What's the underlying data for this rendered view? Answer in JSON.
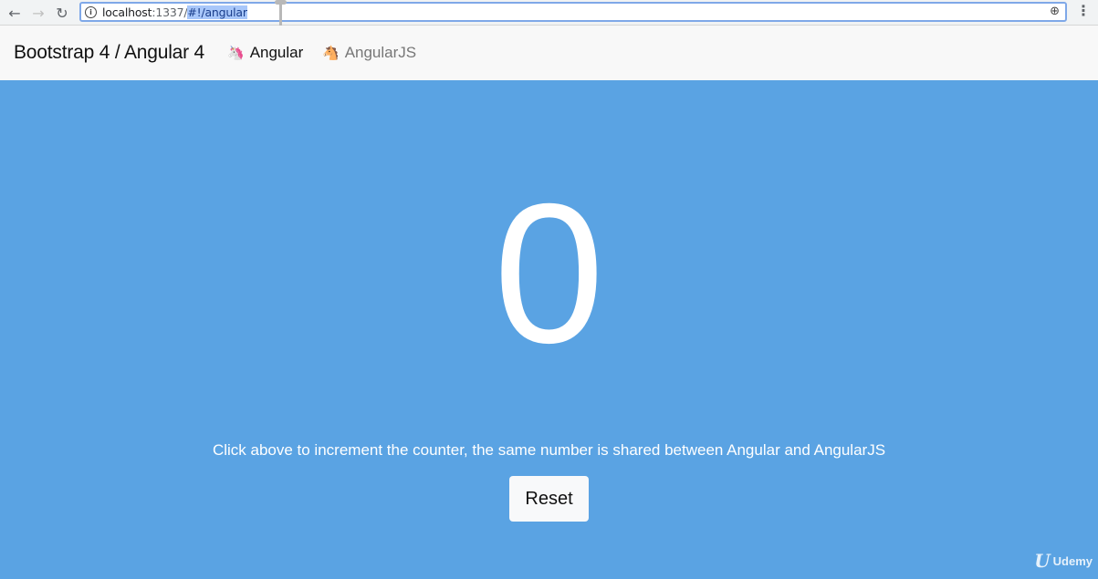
{
  "browser": {
    "url_host": "localhost",
    "url_port": ":1337/",
    "url_selected": "#!/angular",
    "back_icon": "arrow-left-icon",
    "forward_icon": "arrow-right-icon",
    "reload_icon": "reload-icon",
    "zoom_icon": "zoom-icon",
    "menu_icon": "kebab-menu-icon"
  },
  "navbar": {
    "brand": "Bootstrap 4 / Angular 4",
    "links": [
      {
        "label": "Angular",
        "icon": "unicorn-icon",
        "active": true
      },
      {
        "label": "AngularJS",
        "icon": "horse-icon",
        "active": false
      }
    ]
  },
  "main": {
    "counter": "0",
    "hint": "Click above to increment the counter, the same number is shared between Angular and AngularJS",
    "reset_label": "Reset"
  },
  "watermark": {
    "text": "Udemy"
  },
  "colors": {
    "hero_bg": "#5aa3e3",
    "navbar_bg": "#f8f8f8",
    "button_bg": "#f8f9fa"
  }
}
